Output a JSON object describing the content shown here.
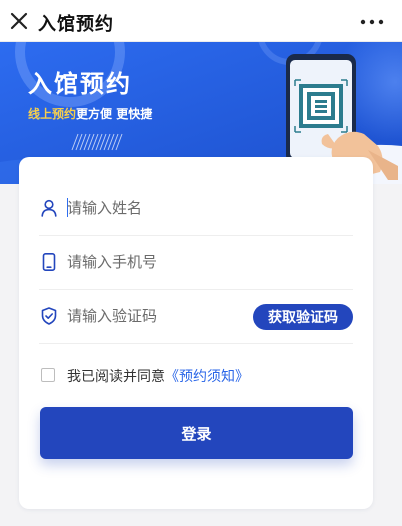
{
  "topbar": {
    "title": "入馆预约",
    "close_icon": "close-icon",
    "more_icon": "more-icon"
  },
  "hero": {
    "title": "入馆预约",
    "subtitle_highlight": "线上预约",
    "subtitle_rest": "更方便 更快捷",
    "colors": {
      "background": "#2a66e8",
      "highlight": "#f6cf4c"
    }
  },
  "form": {
    "name_placeholder": "请输入姓名",
    "phone_placeholder": "请输入手机号",
    "code_placeholder": "请输入验证码",
    "get_code_label": "获取验证码",
    "agree_prefix": "我已阅读并同意",
    "agree_link": "《预约须知》",
    "agree_checked": false,
    "login_label": "登录",
    "icons": [
      "user-icon",
      "phone-icon",
      "shield-icon"
    ],
    "colors": {
      "primary": "#2346bd",
      "link": "#2a66e8"
    }
  }
}
